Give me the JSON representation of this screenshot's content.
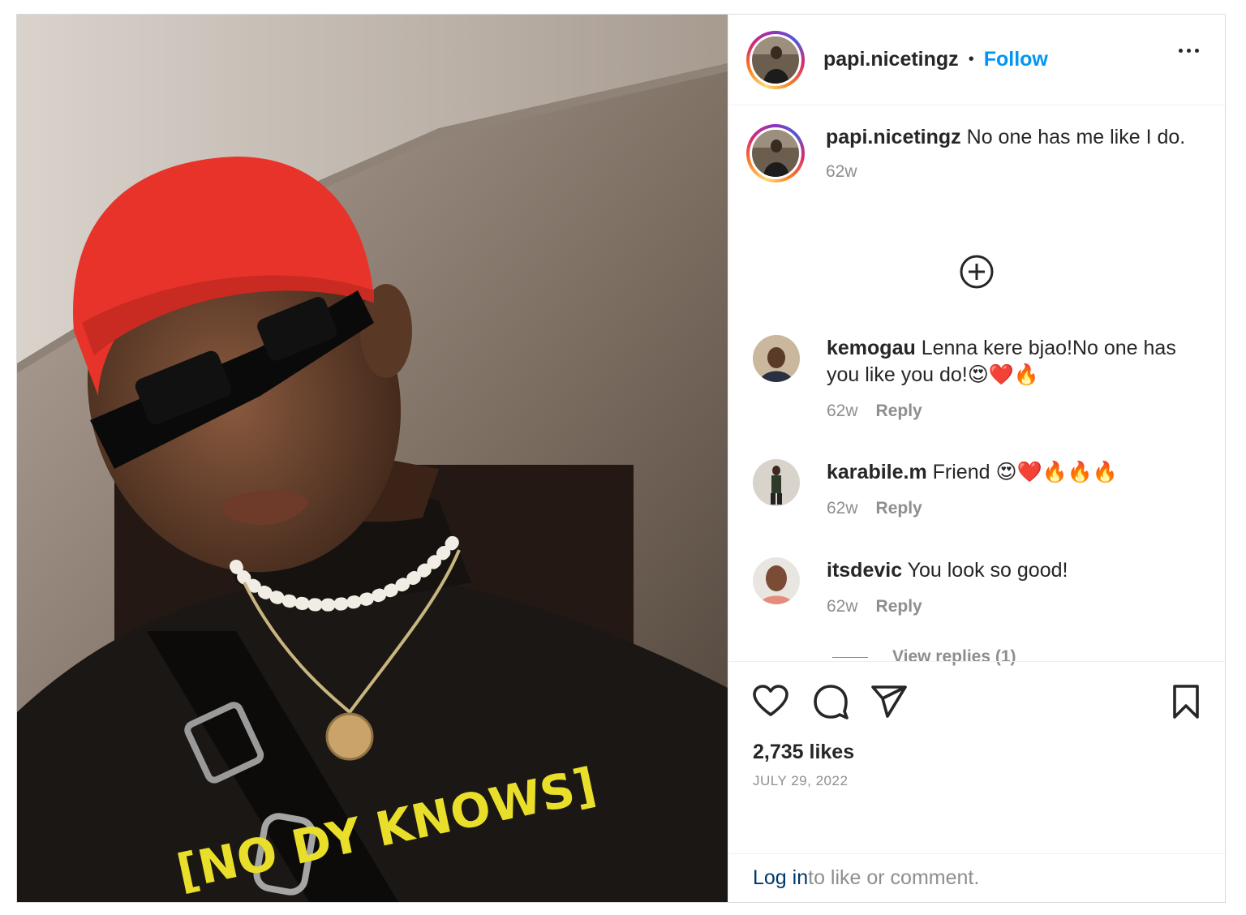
{
  "post": {
    "author": "papi.nicetingz",
    "separator": "•",
    "follow_label": "Follow",
    "photo_alt": "[NO DY KNOWS]",
    "shirt_text": "[NO  DY KNOWS]"
  },
  "caption": {
    "username": "papi.nicetingz",
    "text": " No one has me like I do.",
    "age": "62w"
  },
  "comments": [
    {
      "username": "kemogau",
      "text": " Lenna kere bjao!No one has you like you do!😍❤️🔥",
      "age": "62w",
      "reply_label": "Reply"
    },
    {
      "username": "karabile.m",
      "text": " Friend 😍❤️🔥🔥🔥",
      "age": "62w",
      "reply_label": "Reply"
    },
    {
      "username": "itsdevic",
      "text": " You look so good!",
      "age": "62w",
      "reply_label": "Reply"
    }
  ],
  "view_replies": "View replies (1)",
  "likes": "2,735 likes",
  "date": "JULY 29, 2022",
  "login": {
    "link": "Log in",
    "rest": " to like or comment."
  },
  "icons": [
    "more-options-icon",
    "load-more-comments-icon",
    "heart-icon",
    "comment-icon",
    "share-icon",
    "bookmark-icon"
  ],
  "colors": {
    "follow": "#0095f6",
    "muted": "#8e8e8e",
    "login_link": "#00376b",
    "hat": "#e8332a"
  }
}
